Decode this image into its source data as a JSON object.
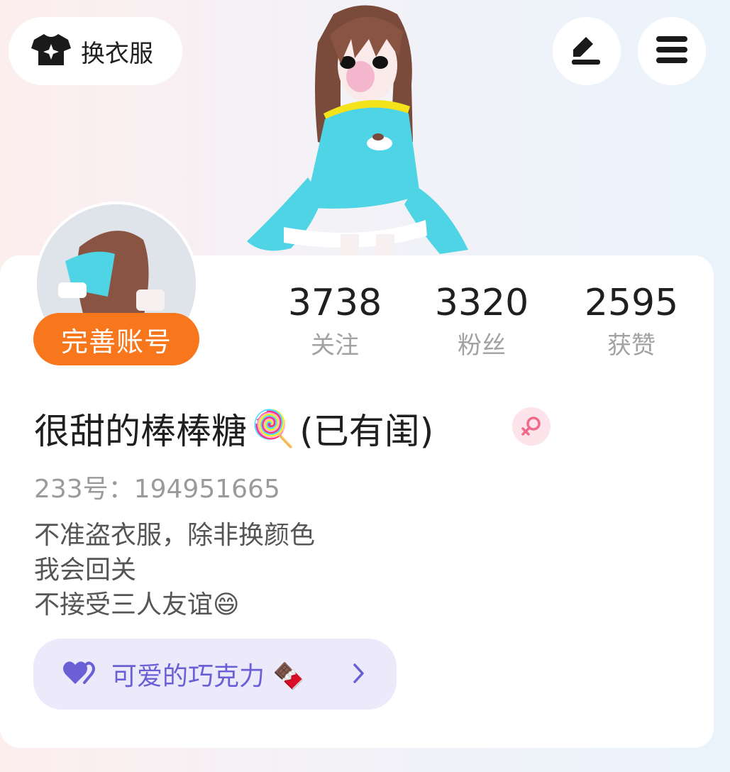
{
  "header": {
    "outfit_label": "换衣服",
    "outfit_icon": "shirt-icon",
    "edit_icon": "pencil-icon",
    "menu_icon": "menu-icon"
  },
  "profile": {
    "complete_label": "完善账号",
    "stats": [
      {
        "value": "3738",
        "label": "关注"
      },
      {
        "value": "3320",
        "label": "粉丝"
      },
      {
        "value": "2595",
        "label": "获赞"
      }
    ],
    "nickname": "很甜的棒棒糖",
    "nickname_emoji": "🍭",
    "nickname_suffix": "(已有闺)",
    "gender_icon": "female-icon",
    "uid": "233号：194951665",
    "bio": [
      "不准盗衣服，除非换颜色",
      "我会回关",
      "不接受三人友谊😄"
    ]
  },
  "bff": {
    "icon": "heart-icon",
    "name": "可爱的巧克力",
    "emoji": "🍫"
  },
  "colors": {
    "accent_orange": "#f8761c",
    "bff_bg": "#ece9fb",
    "bff_text": "#6b5fd6",
    "gender_pink": "#f06a8a"
  }
}
